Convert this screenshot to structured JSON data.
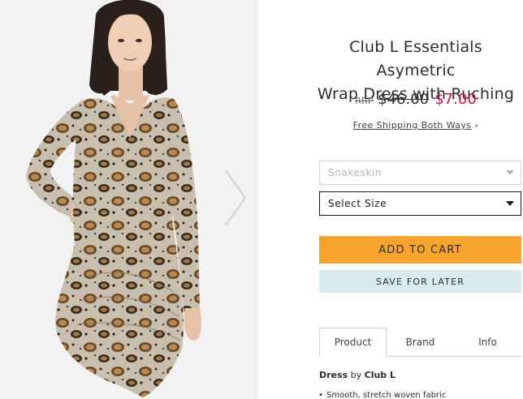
{
  "product": {
    "title_line1": "Club L Essentials Asymetric",
    "title_line2": "Wrap Dress with Ruching",
    "rrp_label": "RRP",
    "rrp_price": "$46.00",
    "sale_price": "$7.00",
    "shipping_link": "Free Shipping Both Ways",
    "shipping_chevron": "›"
  },
  "options": {
    "color_value": "Snakeskin",
    "size_value": "Select Size"
  },
  "actions": {
    "add_to_cart": "ADD TO CART",
    "save_for_later": "SAVE FOR LATER"
  },
  "tabs": [
    "Product",
    "Brand",
    "Info"
  ],
  "description": {
    "product_word": "Dress",
    "by_word": "by",
    "brand": "Club L",
    "bullet1": "Smooth, stretch woven fabric"
  },
  "colors": {
    "accent_cart": "#f7a42e",
    "save_bg": "#d8ecf0",
    "sale_red": "#d01345"
  },
  "icons": {
    "image_next": "chevron-right-icon",
    "dropdown": "caret-down-icon"
  }
}
